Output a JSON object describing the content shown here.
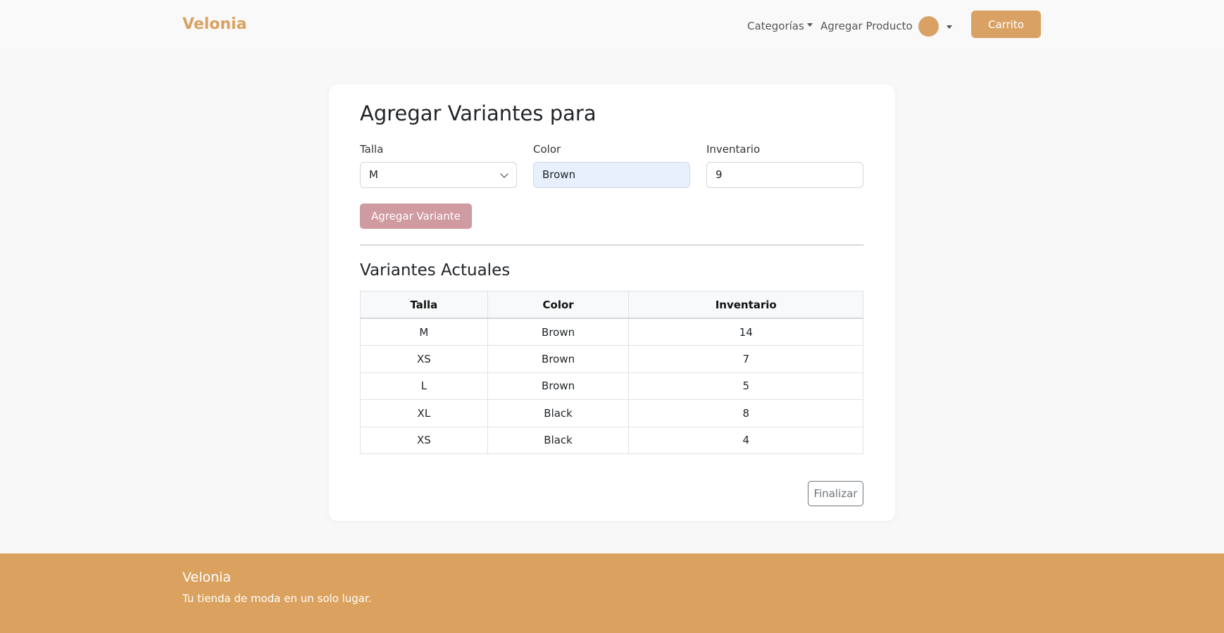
{
  "navbar": {
    "brand": "Velonia",
    "categories_label": "Categorías",
    "add_product_label": "Agregar Producto",
    "cart_label": "Carrito"
  },
  "form": {
    "title": "Agregar Variantes para",
    "size_label": "Talla",
    "size_value": "M",
    "color_label": "Color",
    "color_value": "Brown",
    "inventory_label": "Inventario",
    "inventory_value": "9",
    "add_variant_label": "Agregar Variante"
  },
  "variants": {
    "title": "Variantes Actuales",
    "columns": [
      "Talla",
      "Color",
      "Inventario"
    ],
    "rows": [
      [
        "M",
        "Brown",
        "14"
      ],
      [
        "XS",
        "Brown",
        "7"
      ],
      [
        "L",
        "Brown",
        "5"
      ],
      [
        "XL",
        "Black",
        "8"
      ],
      [
        "XS",
        "Black",
        "4"
      ]
    ]
  },
  "finish_label": "Finalizar",
  "footer": {
    "brand": "Velonia",
    "tagline": "Tu tienda de moda en un solo lugar."
  },
  "colors": {
    "accent": "#d9a264",
    "add_variant_button": "#cf9aa0",
    "footer": "#dba25f"
  },
  "icons": {
    "categories_dropdown": "caret-down-icon",
    "user_menu": "caret-down-icon",
    "select": "chevron-down-icon"
  }
}
